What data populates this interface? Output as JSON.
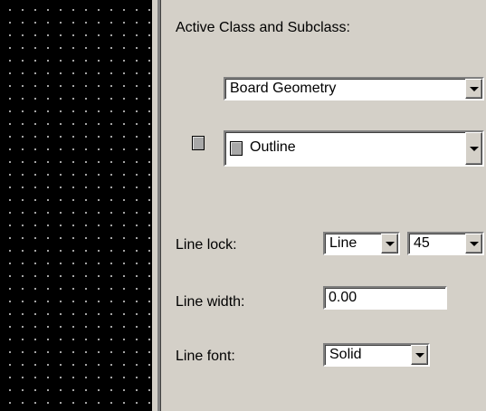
{
  "panel": {
    "header": "Active Class and Subclass:",
    "class_select": {
      "value": "Board Geometry"
    },
    "subclass_select": {
      "value": "Outline"
    },
    "line_lock": {
      "label": "Line lock:",
      "mode_value": "Line",
      "angle_value": "45"
    },
    "line_width": {
      "label": "Line width:",
      "value": "0.00"
    },
    "line_font": {
      "label": "Line font:",
      "value": "Solid"
    }
  },
  "icons": {
    "color_swatch": "color-swatch-icon",
    "dropdown": "chevron-down-icon"
  },
  "colors": {
    "canvas_background": "#000000",
    "grid_dots": "#bdbdbd",
    "panel_background": "#d4d0c8",
    "subclass_color": "#a8a8a8"
  }
}
